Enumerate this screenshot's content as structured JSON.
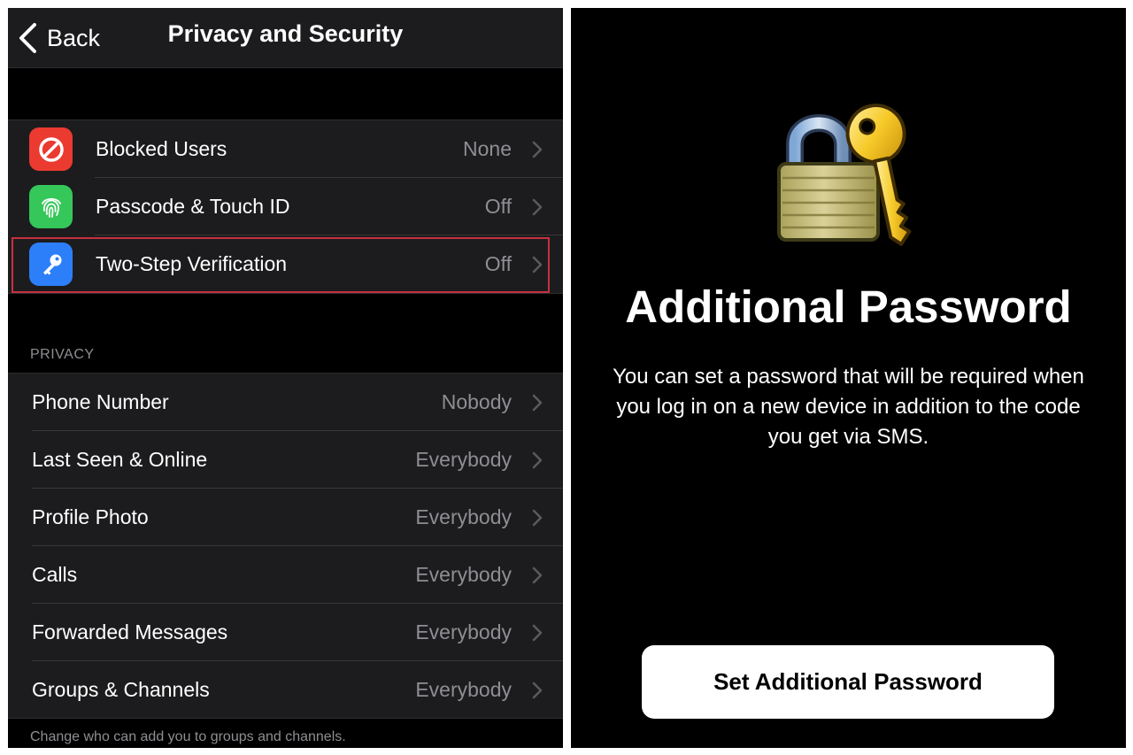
{
  "navbar": {
    "back_label": "Back",
    "title": "Privacy and Security"
  },
  "security": {
    "items": [
      {
        "label": "Blocked Users",
        "value": "None",
        "icon": "blocked-icon",
        "color": "#eb3a30"
      },
      {
        "label": "Passcode & Touch ID",
        "value": "Off",
        "icon": "fingerprint-icon",
        "color": "#35c759"
      },
      {
        "label": "Two-Step Verification",
        "value": "Off",
        "icon": "key-icon",
        "color": "#2d7ff9"
      }
    ]
  },
  "privacy": {
    "header": "PRIVACY",
    "items": [
      {
        "label": "Phone Number",
        "value": "Nobody"
      },
      {
        "label": "Last Seen & Online",
        "value": "Everybody"
      },
      {
        "label": "Profile Photo",
        "value": "Everybody"
      },
      {
        "label": "Calls",
        "value": "Everybody"
      },
      {
        "label": "Forwarded Messages",
        "value": "Everybody"
      },
      {
        "label": "Groups & Channels",
        "value": "Everybody"
      }
    ],
    "footer": "Change who can add you to groups and channels."
  },
  "additional_password": {
    "icon": "lock-and-key-icon",
    "title": "Additional Password",
    "description": "You can set a password that will be required when you log in on a new device in addition to the code you get via SMS.",
    "button_label": "Set Additional Password"
  },
  "colors": {
    "background": "#000000",
    "cell": "#1c1c1e",
    "secondary_text": "#8e8e93",
    "highlight": "#c6303e"
  }
}
